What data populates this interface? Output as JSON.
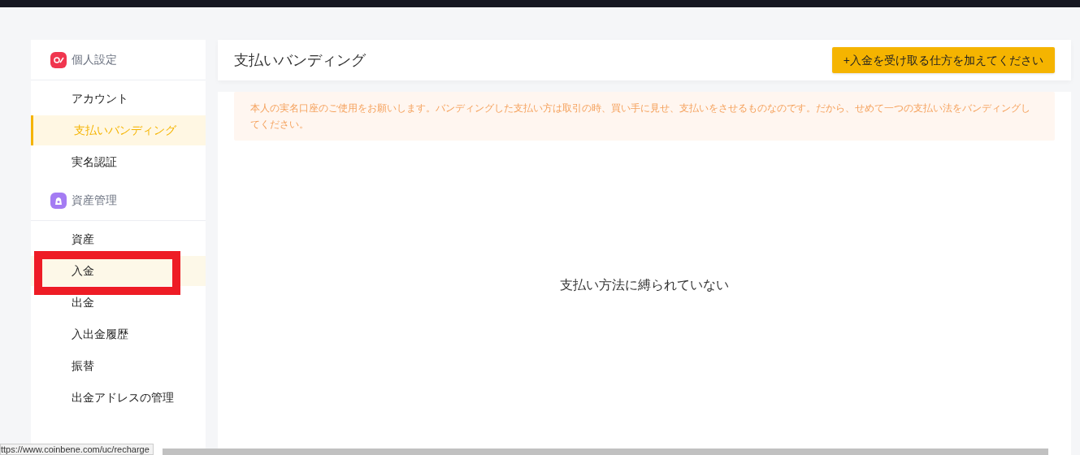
{
  "sidebar": {
    "groups": [
      {
        "title": "個人設定",
        "kind": "settings",
        "items": [
          {
            "label": "アカウント",
            "selected": false,
            "hovered": false
          },
          {
            "label": "支払いバンディング",
            "selected": true,
            "hovered": false
          },
          {
            "label": "実名認証",
            "selected": false,
            "hovered": false
          }
        ]
      },
      {
        "title": "資産管理",
        "kind": "assets",
        "items": [
          {
            "label": "資産",
            "selected": false,
            "hovered": false
          },
          {
            "label": "入金",
            "selected": false,
            "hovered": true,
            "annotated": true
          },
          {
            "label": "出金",
            "selected": false,
            "hovered": false
          },
          {
            "label": "入出金履歴",
            "selected": false,
            "hovered": false
          },
          {
            "label": "振替",
            "selected": false,
            "hovered": false
          },
          {
            "label": "出金アドレスの管理",
            "selected": false,
            "hovered": false
          }
        ]
      }
    ]
  },
  "main": {
    "title": "支払いバンディング",
    "add_button": "+入金を受け取る仕方を加えてください",
    "notice": "本人の実名口座のご使用をお願いします。バンディングした支払い方は取引の時、買い手に見せ、支払いをさせるものなのです。だから、せめて一つの支払い法をバンディングしてください。",
    "empty_text": "支払い方法に縛られていない"
  },
  "status_url": "ttps://www.coinbene.com/uc/recharge"
}
